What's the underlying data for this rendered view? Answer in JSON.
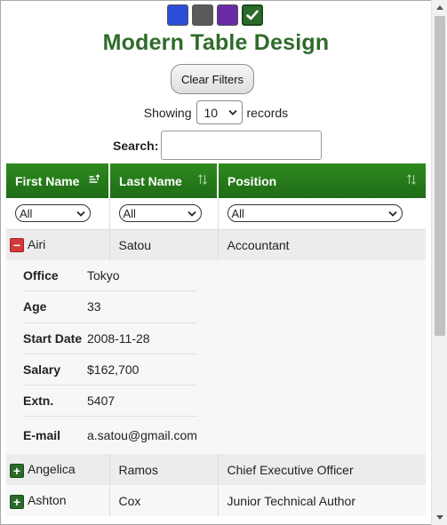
{
  "theme": {
    "swatches": [
      {
        "name": "blue",
        "color": "#2a4fd6"
      },
      {
        "name": "gray",
        "color": "#5a5a5a"
      },
      {
        "name": "purple",
        "color": "#6a2aa8"
      },
      {
        "name": "green",
        "color": "#2d6a2a",
        "selected": true
      }
    ]
  },
  "title": "Modern Table Design",
  "clear_filters_label": "Clear Filters",
  "length": {
    "prefix": "Showing",
    "value": "10",
    "suffix": "records"
  },
  "search": {
    "label": "Search:",
    "value": ""
  },
  "table": {
    "headers": [
      "First Name",
      "Last Name",
      "Position"
    ],
    "filters": [
      "All",
      "All",
      "All"
    ],
    "expanded_row": {
      "first": "Airi",
      "last": "Satou",
      "position": "Accountant"
    },
    "details": [
      {
        "key": "Office",
        "value": "Tokyo"
      },
      {
        "key": "Age",
        "value": "33"
      },
      {
        "key": "Start Date",
        "value": "2008-11-28"
      },
      {
        "key": "Salary",
        "value": "$162,700"
      },
      {
        "key": "Extn.",
        "value": "5407"
      },
      {
        "key": "E-mail",
        "value": "a.satou@gmail.com"
      }
    ],
    "rows": [
      {
        "first": "Angelica",
        "last": "Ramos",
        "position": "Chief Executive Officer"
      },
      {
        "first": "Ashton",
        "last": "Cox",
        "position": "Junior Technical Author"
      }
    ]
  }
}
